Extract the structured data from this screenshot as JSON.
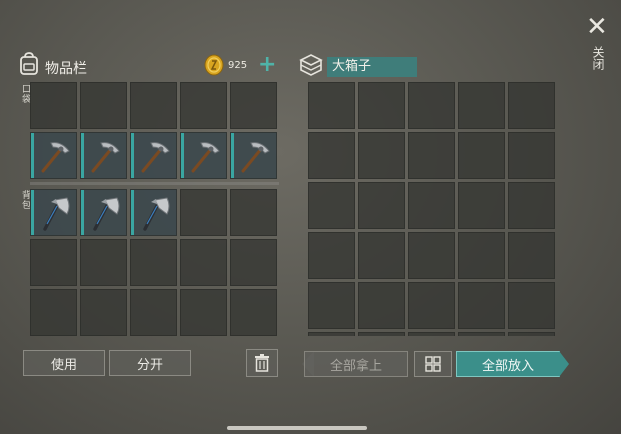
{
  "inventory": {
    "title": "物品栏",
    "icon": "backpack-icon",
    "coins": "925",
    "add_label": "+",
    "pocket_label": "口袋",
    "backpack_label": "背包",
    "pocket_rows": [
      [
        null,
        null,
        null,
        null,
        null
      ],
      [
        "pickaxe",
        "pickaxe",
        "pickaxe",
        "pickaxe",
        "pickaxe"
      ]
    ],
    "backpack_rows": [
      [
        "hatchet",
        "hatchet",
        "hatchet",
        null,
        null
      ],
      [
        null,
        null,
        null,
        null,
        null
      ],
      [
        null,
        null,
        null,
        null,
        null
      ]
    ]
  },
  "chest": {
    "title": "大箱子",
    "icon": "chest-icon",
    "rows": 6,
    "cols": 5
  },
  "close": {
    "icon": "close-icon",
    "label": "关闭"
  },
  "buttons": {
    "use": "使用",
    "split": "分开",
    "trash_icon": "trash-icon",
    "take_all": "全部拿上",
    "sort_icon": "grid-sort-icon",
    "put_all": "全部放入"
  },
  "colors": {
    "accent": "#3aa6a2",
    "coin": "#d9a520"
  }
}
